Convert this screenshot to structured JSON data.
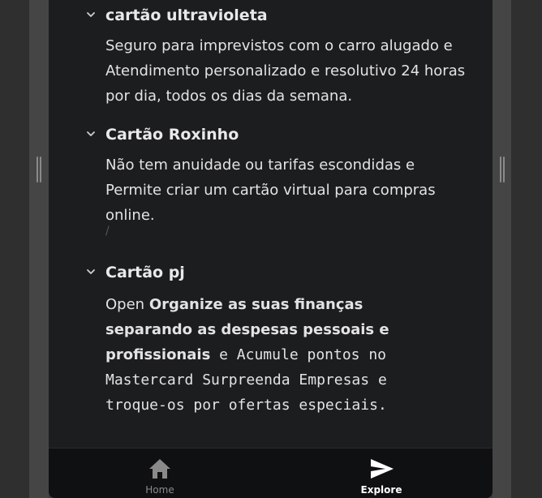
{
  "faq": {
    "items": [
      {
        "title": "cartão ultravioleta",
        "body_a": "Seguro para imprevistos com o carro alugado",
        "body_b": " e Atendimento personalizado e resolutivo 24 horas por dia, todos os dias da semana."
      },
      {
        "title": "Cartão Roxinho",
        "body": "Não tem anuidade ou tarifas escondidas e Permite criar um cartão virtual para compras online.",
        "stray_mark": "/"
      },
      {
        "title": "Cartão pj",
        "body_open": "Open ",
        "body_strong": "Organize as suas finanças separando as despesas pessoais e profissionais",
        "body_mono": " e Acumule pontos no Mastercard Surpreenda Empresas e troque-os por ofertas especiais."
      }
    ]
  },
  "bottom_nav": {
    "home_label": "Home",
    "explore_label": "Explore"
  },
  "colors": {
    "background": "#1c1d1f",
    "nav_background": "#0f1011",
    "text": "#e3e3e3",
    "inactive_nav": "#8a8a8a"
  },
  "icons": {
    "chevron": "chevron-down-icon",
    "home": "home-icon",
    "explore": "send-icon"
  }
}
